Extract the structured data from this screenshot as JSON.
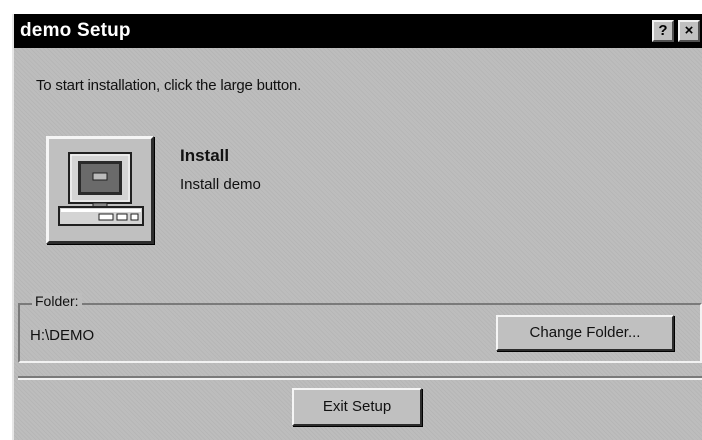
{
  "window": {
    "title": "demo Setup",
    "help_button": "?",
    "close_button": "×"
  },
  "main": {
    "instruction": "To start installation, click the large button.",
    "install": {
      "title": "Install",
      "description": "Install demo",
      "icon": "computer-icon"
    }
  },
  "folder": {
    "legend": "Folder:",
    "path": "H:\\DEMO",
    "change_button": "Change Folder..."
  },
  "footer": {
    "exit_button": "Exit Setup"
  },
  "colors": {
    "title_bar": "#000000",
    "dialog_face": "#bdbdbd"
  }
}
